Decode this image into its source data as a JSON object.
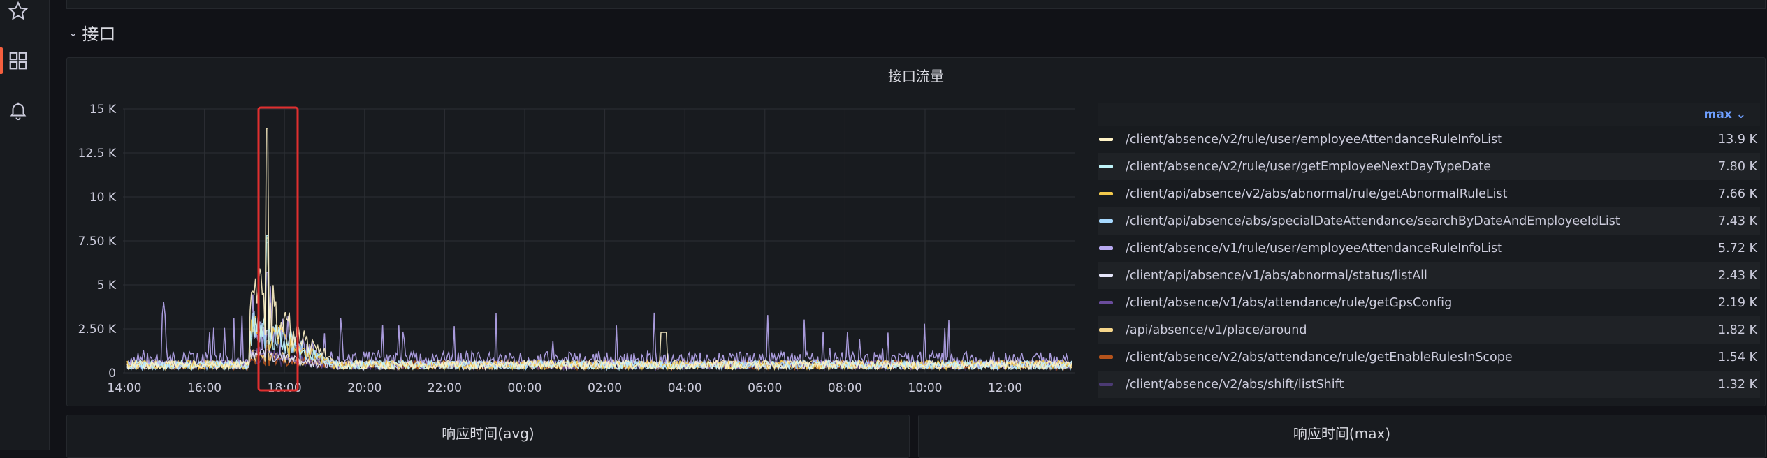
{
  "row": {
    "title": "接口"
  },
  "panel": {
    "title": "接口流量",
    "legend_sort_label": "max"
  },
  "bottom_panels": [
    {
      "title": "响应时间(avg)"
    },
    {
      "title": "响应时间(max)"
    }
  ],
  "colors": {
    "highlight_box": "#e02f2f",
    "grid": "#2c2f34",
    "accent_sort": "#6e9fff"
  },
  "chart_data": {
    "type": "line",
    "title": "接口流量",
    "x_ticks": [
      "14:00",
      "16:00",
      "18:00",
      "20:00",
      "22:00",
      "00:00",
      "02:00",
      "04:00",
      "06:00",
      "08:00",
      "10:00",
      "12:00"
    ],
    "y_ticks": [
      "0",
      "2.50 K",
      "5 K",
      "7.50 K",
      "10 K",
      "12.5 K",
      "15 K"
    ],
    "ylim": [
      0,
      15000
    ],
    "grid": true,
    "legend_position": "right",
    "series": [
      {
        "name": "/client/absence/v2/rule/user/employeeAttendanceRuleInfoList",
        "max": "13.9 K",
        "color": "#fff3c7",
        "peak_value": 13900
      },
      {
        "name": "/client/absence/v2/rule/user/getEmployeeNextDayTypeDate",
        "max": "7.80 K",
        "color": "#c0f4f9",
        "peak_value": 7800
      },
      {
        "name": "/client/api/absence/v2/abs/abnormal/rule/getAbnormalRuleList",
        "max": "7.66 K",
        "color": "#f2c94c",
        "peak_value": 7660
      },
      {
        "name": "/client/api/absence/abs/specialDateAttendance/searchByDateAndEmployeeIdList",
        "max": "7.43 K",
        "color": "#a7d9ff",
        "peak_value": 7430
      },
      {
        "name": "/client/absence/v1/rule/user/employeeAttendanceRuleInfoList",
        "max": "5.72 K",
        "color": "#b8a9f0",
        "peak_value": 5720
      },
      {
        "name": "/client/api/absence/v1/abs/abnormal/status/listAll",
        "max": "2.43 K",
        "color": "#e6e6fa",
        "peak_value": 2430
      },
      {
        "name": "/client/absence/v1/abs/attendance/rule/getGpsConfig",
        "max": "2.19 K",
        "color": "#6a4c9c",
        "peak_value": 2190
      },
      {
        "name": "/api/absence/v1/place/around",
        "max": "1.82 K",
        "color": "#f5d58a",
        "peak_value": 1820
      },
      {
        "name": "/client/absence/v2/abs/attendance/rule/getEnableRulesInScope",
        "max": "1.54 K",
        "color": "#b5531b",
        "peak_value": 1540
      },
      {
        "name": "/client/absence/v2/abs/shift/listShift",
        "max": "1.32 K",
        "color": "#4b3a73",
        "peak_value": 1320
      }
    ]
  }
}
